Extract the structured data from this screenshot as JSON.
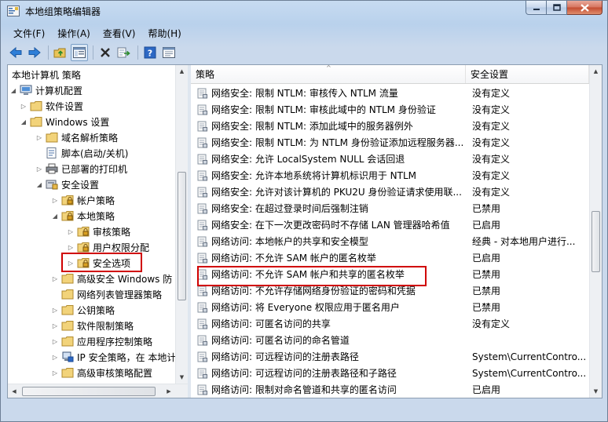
{
  "window": {
    "title": "本地组策略编辑器",
    "icon": "policy-editor-icon"
  },
  "menu": [
    "文件(F)",
    "操作(A)",
    "查看(V)",
    "帮助(H)"
  ],
  "toolbar_icons": [
    "back-arrow-icon",
    "forward-arrow-icon",
    "up-folder-icon",
    "show-hide-tree-icon",
    "delete-icon",
    "export-list-icon",
    "help-icon",
    "properties-icon"
  ],
  "tree": {
    "items": [
      {
        "label": "本地计算机 策略",
        "icon": "none"
      },
      {
        "label": "计算机配置",
        "icon": "computer-icon"
      },
      {
        "label": "软件设置",
        "icon": "folder-icon"
      },
      {
        "label": "Windows 设置",
        "icon": "folder-icon"
      },
      {
        "label": "域名解析策略",
        "icon": "folder-icon"
      },
      {
        "label": "脚本(启动/关机)",
        "icon": "script-icon"
      },
      {
        "label": "已部署的打印机",
        "icon": "printer-icon"
      },
      {
        "label": "安全设置",
        "icon": "security-settings-icon"
      },
      {
        "label": "帐户策略",
        "icon": "lock-folder-icon"
      },
      {
        "label": "本地策略",
        "icon": "lock-folder-icon"
      },
      {
        "label": "审核策略",
        "icon": "lock-folder-icon"
      },
      {
        "label": "用户权限分配",
        "icon": "lock-folder-icon"
      },
      {
        "label": "安全选项",
        "icon": "lock-folder-icon"
      },
      {
        "label": "高级安全 Windows 防",
        "icon": "folder-icon"
      },
      {
        "label": "网络列表管理器策略",
        "icon": "folder-icon"
      },
      {
        "label": "公钥策略",
        "icon": "folder-icon"
      },
      {
        "label": "软件限制策略",
        "icon": "folder-icon"
      },
      {
        "label": "应用程序控制策略",
        "icon": "folder-icon"
      },
      {
        "label": "IP 安全策略，在 本地计",
        "icon": "ip-security-icon"
      },
      {
        "label": "高级审核策略配置",
        "icon": "folder-icon"
      }
    ]
  },
  "list": {
    "columns": [
      "策略",
      "安全设置"
    ],
    "rows": [
      {
        "policy": "网络安全: 限制 NTLM: 审核传入 NTLM 流量",
        "setting": "没有定义"
      },
      {
        "policy": "网络安全: 限制 NTLM: 审核此域中的 NTLM 身份验证",
        "setting": "没有定义"
      },
      {
        "policy": "网络安全: 限制 NTLM: 添加此域中的服务器例外",
        "setting": "没有定义"
      },
      {
        "policy": "网络安全: 限制 NTLM: 为 NTLM 身份验证添加远程服务器...",
        "setting": "没有定义"
      },
      {
        "policy": "网络安全: 允许 LocalSystem NULL 会话回退",
        "setting": "没有定义"
      },
      {
        "policy": "网络安全: 允许本地系统将计算机标识用于 NTLM",
        "setting": "没有定义"
      },
      {
        "policy": "网络安全: 允许对该计算机的 PKU2U 身份验证请求使用联...",
        "setting": "没有定义"
      },
      {
        "policy": "网络安全: 在超过登录时间后强制注销",
        "setting": "已禁用"
      },
      {
        "policy": "网络安全: 在下一次更改密码时不存储 LAN 管理器哈希值",
        "setting": "已启用"
      },
      {
        "policy": "网络访问: 本地帐户的共享和安全模型",
        "setting": "经典 - 对本地用户进行..."
      },
      {
        "policy": "网络访问: 不允许 SAM 帐户的匿名枚举",
        "setting": "已启用"
      },
      {
        "policy": "网络访问: 不允许 SAM 帐户和共享的匿名枚举",
        "setting": "已禁用"
      },
      {
        "policy": "网络访问: 不允许存储网络身份验证的密码和凭据",
        "setting": "已禁用"
      },
      {
        "policy": "网络访问: 将 Everyone 权限应用于匿名用户",
        "setting": "已禁用"
      },
      {
        "policy": "网络访问: 可匿名访问的共享",
        "setting": "没有定义"
      },
      {
        "policy": "网络访问: 可匿名访问的命名管道",
        "setting": ""
      },
      {
        "policy": "网络访问: 可远程访问的注册表路径",
        "setting": "System\\CurrentContro..."
      },
      {
        "policy": "网络访问: 可远程访问的注册表路径和子路径",
        "setting": "System\\CurrentContro..."
      },
      {
        "policy": "网络访问: 限制对命名管道和共享的匿名访问",
        "setting": "已启用"
      }
    ]
  },
  "highlight_color": "#d00000"
}
